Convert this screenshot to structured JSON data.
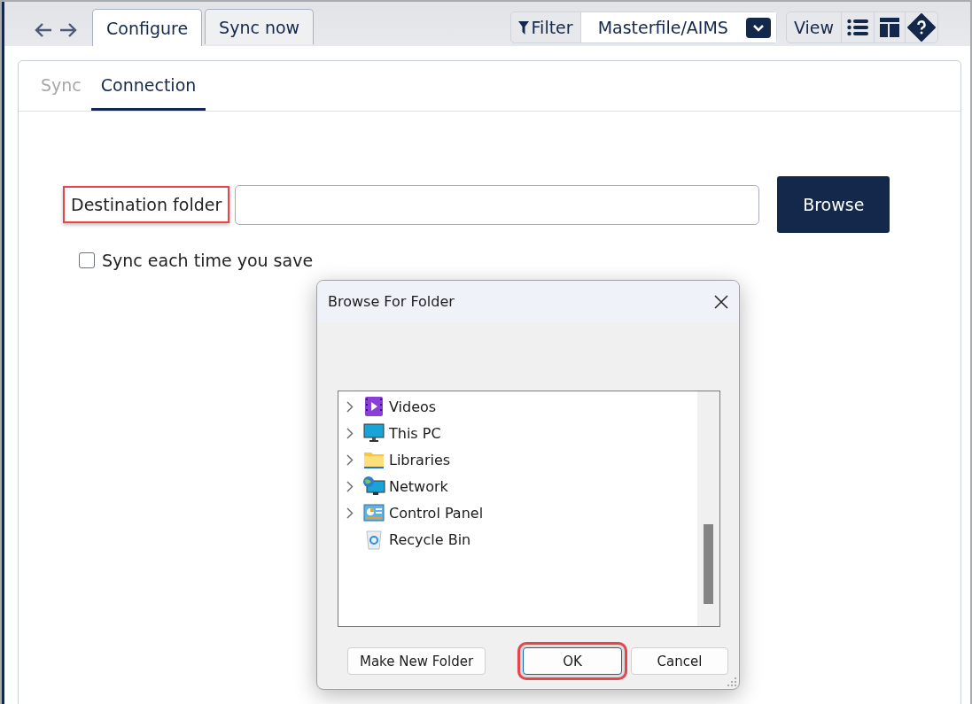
{
  "tabs": [
    {
      "label": "Configure",
      "selected": true
    },
    {
      "label": "Sync now",
      "selected": false
    }
  ],
  "toolbar": {
    "filter_label": "Filter",
    "filter_value": "Masterfile/AIMS",
    "view_label": "View"
  },
  "subtabs": [
    {
      "label": "Sync",
      "selected": false
    },
    {
      "label": "Connection",
      "selected": true
    }
  ],
  "destination": {
    "label": "Destination folder",
    "highlighted": true,
    "button": "Browse"
  },
  "sync_on_save": {
    "label": "Sync each time you save",
    "checked": false
  },
  "dialog": {
    "title": "Browse For Folder",
    "tree": [
      {
        "label": "Videos",
        "kind": "videos",
        "expandable": true
      },
      {
        "label": "This PC",
        "kind": "pc",
        "expandable": true
      },
      {
        "label": "Libraries",
        "kind": "folder",
        "expandable": true
      },
      {
        "label": "Network",
        "kind": "network",
        "expandable": true
      },
      {
        "label": "Control Panel",
        "kind": "control",
        "expandable": true
      },
      {
        "label": "Recycle Bin",
        "kind": "recycle",
        "expandable": false
      }
    ],
    "buttons": [
      {
        "label": "Make New Folder",
        "default": false,
        "highlighted": false
      },
      {
        "label": "OK",
        "default": true,
        "highlighted": true
      },
      {
        "label": "Cancel",
        "default": false,
        "highlighted": false
      }
    ]
  }
}
